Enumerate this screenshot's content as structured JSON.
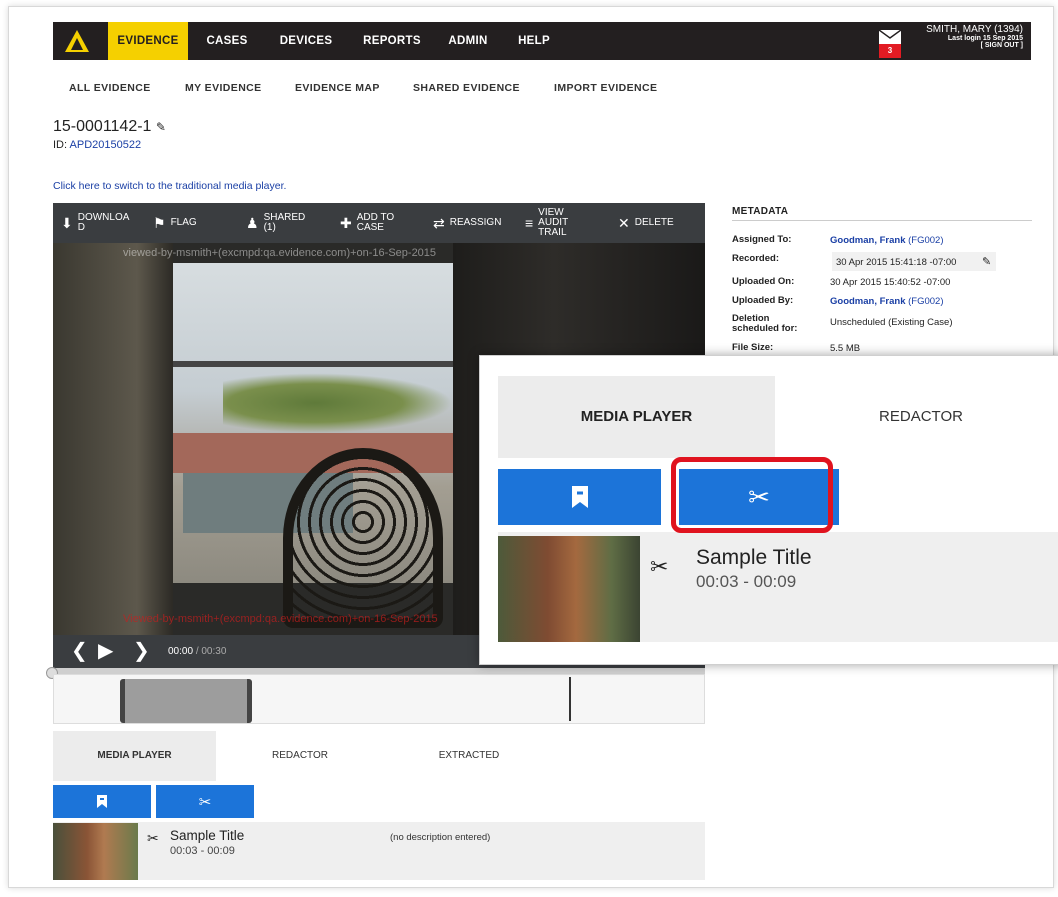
{
  "nav": {
    "items": [
      "EVIDENCE",
      "CASES",
      "DEVICES",
      "REPORTS",
      "ADMIN",
      "HELP"
    ],
    "mail_count": "3",
    "user_name": "SMITH, MARY (1394)",
    "last_login": "Last login 15 Sep 2015",
    "sign_out": "[ SIGN OUT ]"
  },
  "subnav": [
    "ALL EVIDENCE",
    "MY EVIDENCE",
    "EVIDENCE MAP",
    "SHARED EVIDENCE",
    "IMPORT EVIDENCE"
  ],
  "evidence": {
    "title": "15-0001142-1",
    "id_label": "ID:",
    "id_value": "APD20150522",
    "switch_link": "Click here to switch to the traditional media player."
  },
  "toolbar": {
    "download": "DOWNLOA D",
    "flag": "FLAG",
    "shared": "SHARED (1)",
    "add_to_case": "ADD TO CASE",
    "reassign": "REASSIGN",
    "audit": "VIEW AUDIT TRAIL",
    "delete": "DELETE"
  },
  "player": {
    "watermark_top": "viewed-by-msmith+(excmpd:qa.evidence.com)+on-16-Sep-2015",
    "watermark_bottom": "Viewed-by-msmith+(excmpd:qa.evidence.com)+on-16-Sep-2015",
    "current_time": "00:00",
    "duration": "/ 00:30"
  },
  "tabs": [
    "MEDIA PLAYER",
    "REDACTOR",
    "EXTRACTED"
  ],
  "clip": {
    "title": "Sample Title",
    "range": "00:03 - 00:09",
    "description": "(no description entered)"
  },
  "metadata": {
    "heading": "METADATA",
    "assigned_to_label": "Assigned To:",
    "assigned_to_name": "Goodman, Frank",
    "assigned_to_code": "(FG002)",
    "recorded_label": "Recorded:",
    "recorded_value": "30 Apr 2015 15:41:18 -07:00",
    "uploaded_on_label": "Uploaded On:",
    "uploaded_on_value": "30 Apr 2015 15:40:52 -07:00",
    "uploaded_by_label": "Uploaded By:",
    "uploaded_by_name": "Goodman, Frank",
    "uploaded_by_code": "(FG002)",
    "deletion_label": "Deletion scheduled for:",
    "deletion_value": "Unscheduled  (Existing Case)",
    "file_size_label": "File Size:",
    "file_size_value": "5.5 MB"
  },
  "zoom": {
    "tab_media": "MEDIA PLAYER",
    "tab_redactor": "REDACTOR",
    "clip_title": "Sample Title",
    "clip_range": "00:03 - 00:09"
  },
  "colors": {
    "accent": "#f5d000",
    "nav_bg": "#231f20",
    "button_blue": "#1c74d9",
    "highlight_red": "#e0131f"
  }
}
